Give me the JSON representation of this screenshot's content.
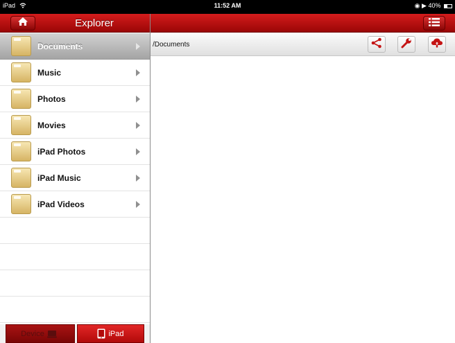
{
  "status_bar": {
    "device": "iPad",
    "time": "11:52 AM",
    "battery": "40%"
  },
  "left_nav": {
    "title": "Explorer"
  },
  "toolbar": {
    "path": "/Documents"
  },
  "sidebar": {
    "items": [
      {
        "label": "Documents",
        "selected": true
      },
      {
        "label": "Music",
        "selected": false
      },
      {
        "label": "Photos",
        "selected": false
      },
      {
        "label": "Movies",
        "selected": false
      },
      {
        "label": "iPad Photos",
        "selected": false
      },
      {
        "label": "iPad Music",
        "selected": false
      },
      {
        "label": "iPad Videos",
        "selected": false
      }
    ]
  },
  "bottom_tabs": {
    "device_label": "Device",
    "ipad_label": "iPad"
  },
  "icons": {
    "home": "home-icon",
    "menu": "list-menu-icon",
    "share": "share-icon",
    "tools": "wrench-icon",
    "upload": "cloud-upload-icon",
    "folder": "folder-icon",
    "device": "device-icon",
    "ipad": "ipad-icon"
  },
  "colors": {
    "accent": "#c41414",
    "nav_dark": "#9a0606"
  }
}
